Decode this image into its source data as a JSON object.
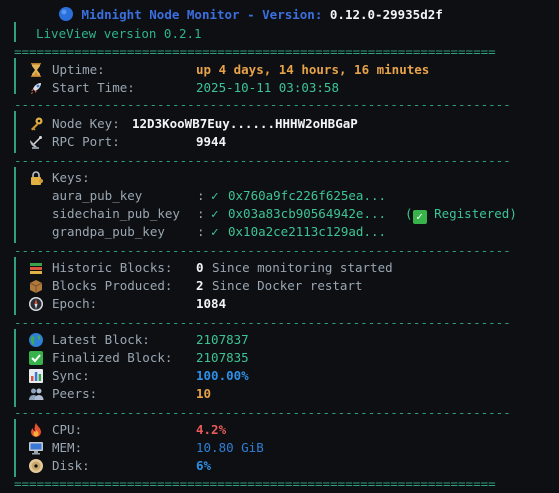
{
  "header": {
    "title": "Midnight Node Monitor - Version:",
    "version": "0.12.0-29935d2f",
    "liveview": "LiveView version 0.2.1"
  },
  "rules": {
    "double": "================================================================",
    "single": "------------------------------------------------------------------"
  },
  "uptime": {
    "label": "Uptime:",
    "value": "up 4 days, 14 hours, 16 minutes"
  },
  "start_time": {
    "label": "Start Time:",
    "value": "2025-10-11 03:03:58"
  },
  "node_key": {
    "label": "Node Key:",
    "value": "12D3KooWB7Euy......HHHW2oHBGaP"
  },
  "rpc_port": {
    "label": "RPC Port:",
    "value": "9944"
  },
  "keys": {
    "label": "Keys:",
    "items": [
      {
        "name": "aura_pub_key",
        "sep": ":",
        "check": "✓",
        "value": "0x760a9fc226f625ea..."
      },
      {
        "name": "sidechain_pub_key",
        "sep": ":",
        "check": "✓",
        "value": "0x03a83cb90564942e...",
        "note_open": "(",
        "note": "Registered",
        "note_close": ")"
      },
      {
        "name": "grandpa_pub_key",
        "sep": ":",
        "check": "✓",
        "value": "0x10a2ce2113c129ad..."
      }
    ]
  },
  "historic_blocks": {
    "label": "Historic Blocks:",
    "value": "0",
    "note": "Since monitoring started"
  },
  "blocks_produced": {
    "label": "Blocks Produced:",
    "value": "2",
    "note": "Since Docker restart"
  },
  "epoch": {
    "label": "Epoch:",
    "value": "1084"
  },
  "latest_block": {
    "label": "Latest Block:",
    "value": "2107837"
  },
  "finalized_block": {
    "label": "Finalized Block:",
    "value": "2107835"
  },
  "sync": {
    "label": "Sync:",
    "value": "100.00%"
  },
  "peers": {
    "label": "Peers:",
    "value": "10"
  },
  "cpu": {
    "label": "CPU:",
    "value": "4.2%"
  },
  "mem": {
    "label": "MEM:",
    "value": "10.80 GiB"
  },
  "disk": {
    "label": "Disk:",
    "value": "6%"
  },
  "colors": {
    "rule": "#2f9f7f",
    "orange": "#e7a24a",
    "green": "#3ec494",
    "blue": "#2f8fe6",
    "red": "#ea5a5a"
  }
}
